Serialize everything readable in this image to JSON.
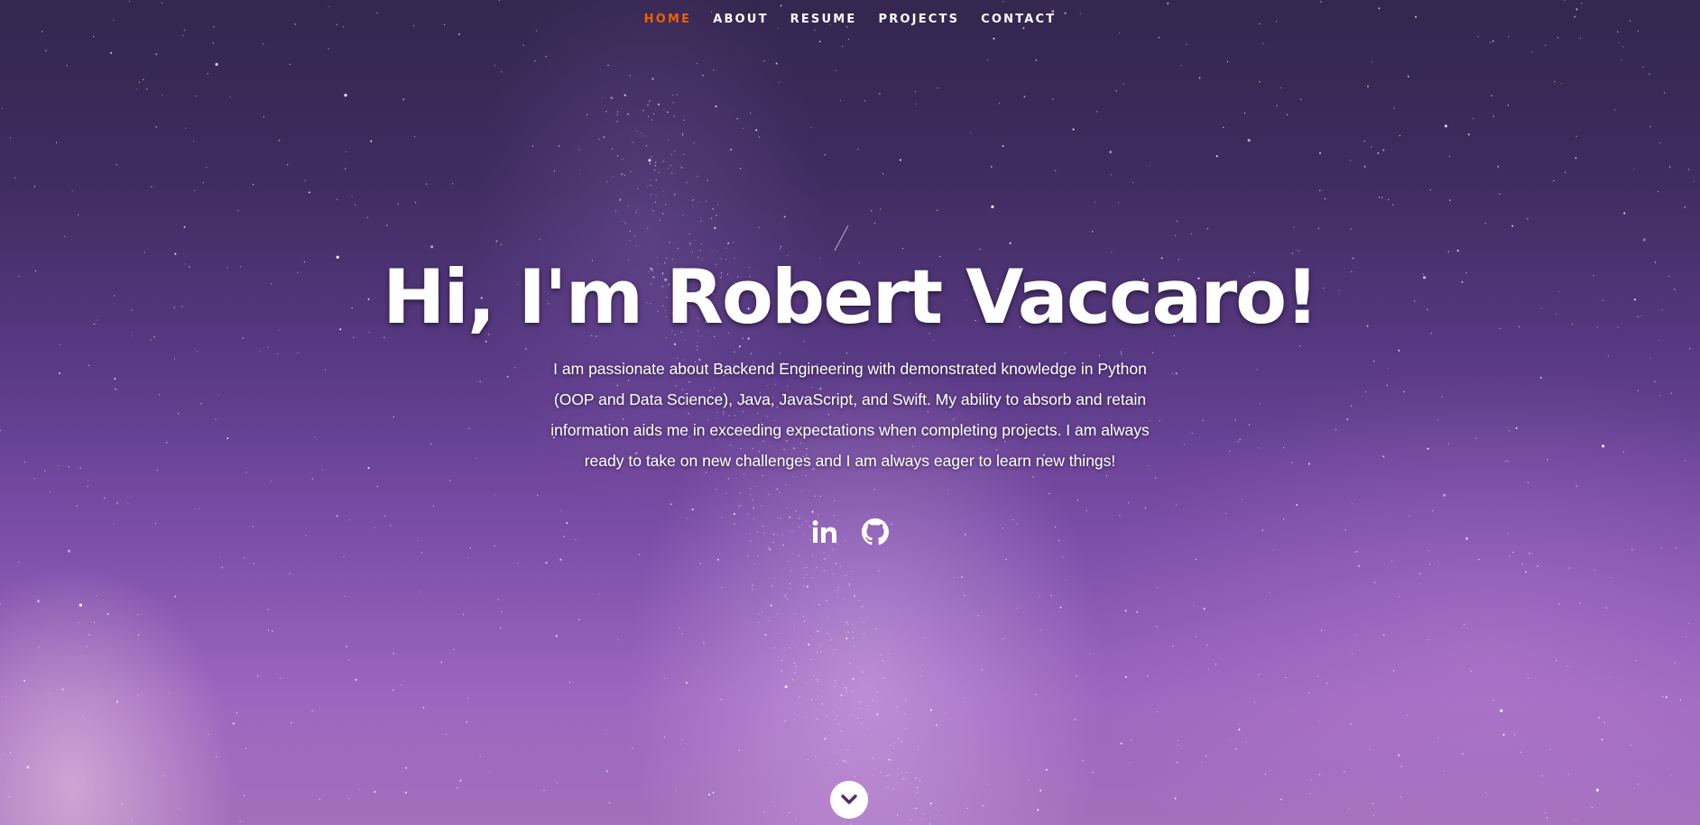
{
  "nav": {
    "items": [
      {
        "label": "HOME",
        "active": true
      },
      {
        "label": "ABOUT",
        "active": false
      },
      {
        "label": "RESUME",
        "active": false
      },
      {
        "label": "PROJECTS",
        "active": false
      },
      {
        "label": "CONTACT",
        "active": false
      }
    ],
    "active_color": "#f06000"
  },
  "hero": {
    "title": "Hi, I'm Robert Vaccaro!",
    "description": "I am passionate about Backend Engineering with demonstrated knowledge in Python (OOP and Data Science), Java, JavaScript, and Swift. My ability to absorb and retain information aids me in exceeding expectations when completing projects. I am always ready to take on new challenges and I am always eager to learn new things!"
  },
  "social": {
    "icons": [
      "linkedin-icon",
      "github-icon"
    ]
  },
  "scroll": {
    "icon": "chevron-down-icon"
  }
}
